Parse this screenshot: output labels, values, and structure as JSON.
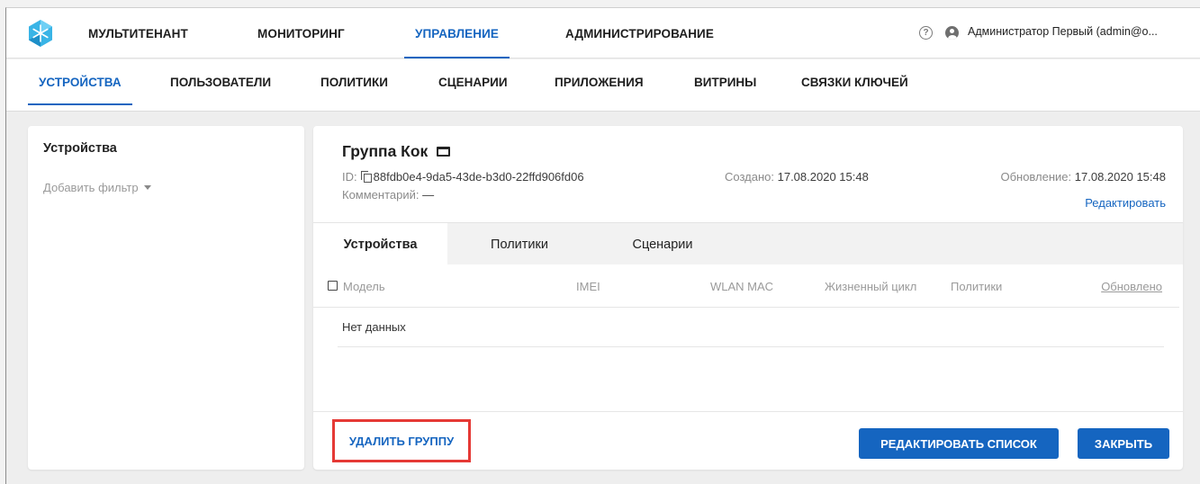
{
  "topnav": {
    "items": [
      {
        "label": "МУЛЬТИТЕНАНТ",
        "active": false
      },
      {
        "label": "МОНИТОРИНГ",
        "active": false
      },
      {
        "label": "УПРАВЛЕНИЕ",
        "active": true
      },
      {
        "label": "АДМИНИСТРИРОВАНИЕ",
        "active": false
      }
    ],
    "help_glyph": "?",
    "user": "Администратор Первый (admin@o..."
  },
  "subnav": {
    "items": [
      {
        "label": "УСТРОЙСТВА",
        "active": true
      },
      {
        "label": "ПОЛЬЗОВАТЕЛИ",
        "active": false
      },
      {
        "label": "ПОЛИТИКИ",
        "active": false
      },
      {
        "label": "СЦЕНАРИИ",
        "active": false
      },
      {
        "label": "ПРИЛОЖЕНИЯ",
        "active": false
      },
      {
        "label": "ВИТРИНЫ",
        "active": false
      },
      {
        "label": "СВЯЗКИ КЛЮЧЕЙ",
        "active": false
      }
    ]
  },
  "left": {
    "title": "Устройства",
    "filter_label": "Добавить фильтр"
  },
  "group": {
    "title": "Группа Кок",
    "id_label": "ID:",
    "id_value": "88fdb0e4-9da5-43de-b3d0-22ffd906fd06",
    "comment_label": "Комментарий:",
    "comment_value": "—",
    "created_label": "Создано:",
    "created_value": "17.08.2020 15:48",
    "updated_label": "Обновление:",
    "updated_value": "17.08.2020 15:48",
    "edit_link": "Редактировать"
  },
  "tabs": [
    {
      "label": "Устройства",
      "active": true
    },
    {
      "label": "Политики",
      "active": false
    },
    {
      "label": "Сценарии",
      "active": false
    }
  ],
  "table": {
    "columns": [
      "Модель",
      "IMEI",
      "WLAN MAC",
      "Жизненный цикл",
      "Политики",
      "Обновлено"
    ],
    "empty": "Нет данных"
  },
  "actions": {
    "delete": "УДАЛИТЬ ГРУППУ",
    "edit_list": "РЕДАКТИРОВАТЬ СПИСОК",
    "close": "ЗАКРЫТЬ"
  },
  "colors": {
    "accent": "#1565c0",
    "highlight": "#e53935",
    "logo": "#39b4e6"
  },
  "icons": [
    "logo-icon",
    "help-icon",
    "user-icon",
    "caret-down-icon",
    "folder-icon",
    "copy-icon",
    "checkbox-icon"
  ]
}
